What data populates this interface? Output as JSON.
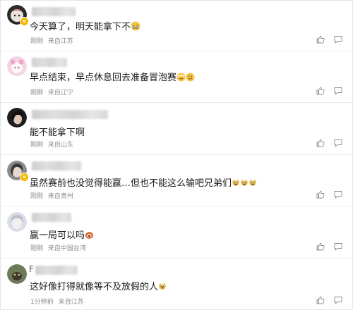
{
  "comments": [
    {
      "username_initial": "",
      "text": "今天算了，明天能拿下不",
      "emojis": [
        "crying-face"
      ],
      "time": "刚刚",
      "location": "来自江苏",
      "verified": true
    },
    {
      "username_initial": "",
      "text": "早点结束，早点休息回去准备冒泡赛",
      "emojis": [
        "sweat-smile-face",
        "smile-face"
      ],
      "time": "刚刚",
      "location": "来自辽宁",
      "verified": false
    },
    {
      "username_initial": "",
      "text": "能不能拿下啊",
      "emojis": [],
      "time": "刚刚",
      "location": "来自山东",
      "verified": false
    },
    {
      "username_initial": "",
      "text": "虽然赛前也没觉得能赢…但也不能这么输吧兄弟们",
      "emojis": [
        "doge-face",
        "doge-face",
        "doge-face"
      ],
      "time": "刚刚",
      "location": "来自贵州",
      "verified": true
    },
    {
      "username_initial": "",
      "text": "赢一局可以吗",
      "emojis": [
        "drooling-face"
      ],
      "time": "刚刚",
      "location": "来自中国台湾",
      "verified": false
    },
    {
      "username_initial": "F",
      "text": "这好像打得就像等不及放假的人",
      "emojis": [
        "doge-face"
      ],
      "time": "1分钟前",
      "location": "来自江苏",
      "verified": false
    }
  ],
  "icons": {
    "like": "thumbs-up-icon",
    "reply": "comment-icon"
  }
}
